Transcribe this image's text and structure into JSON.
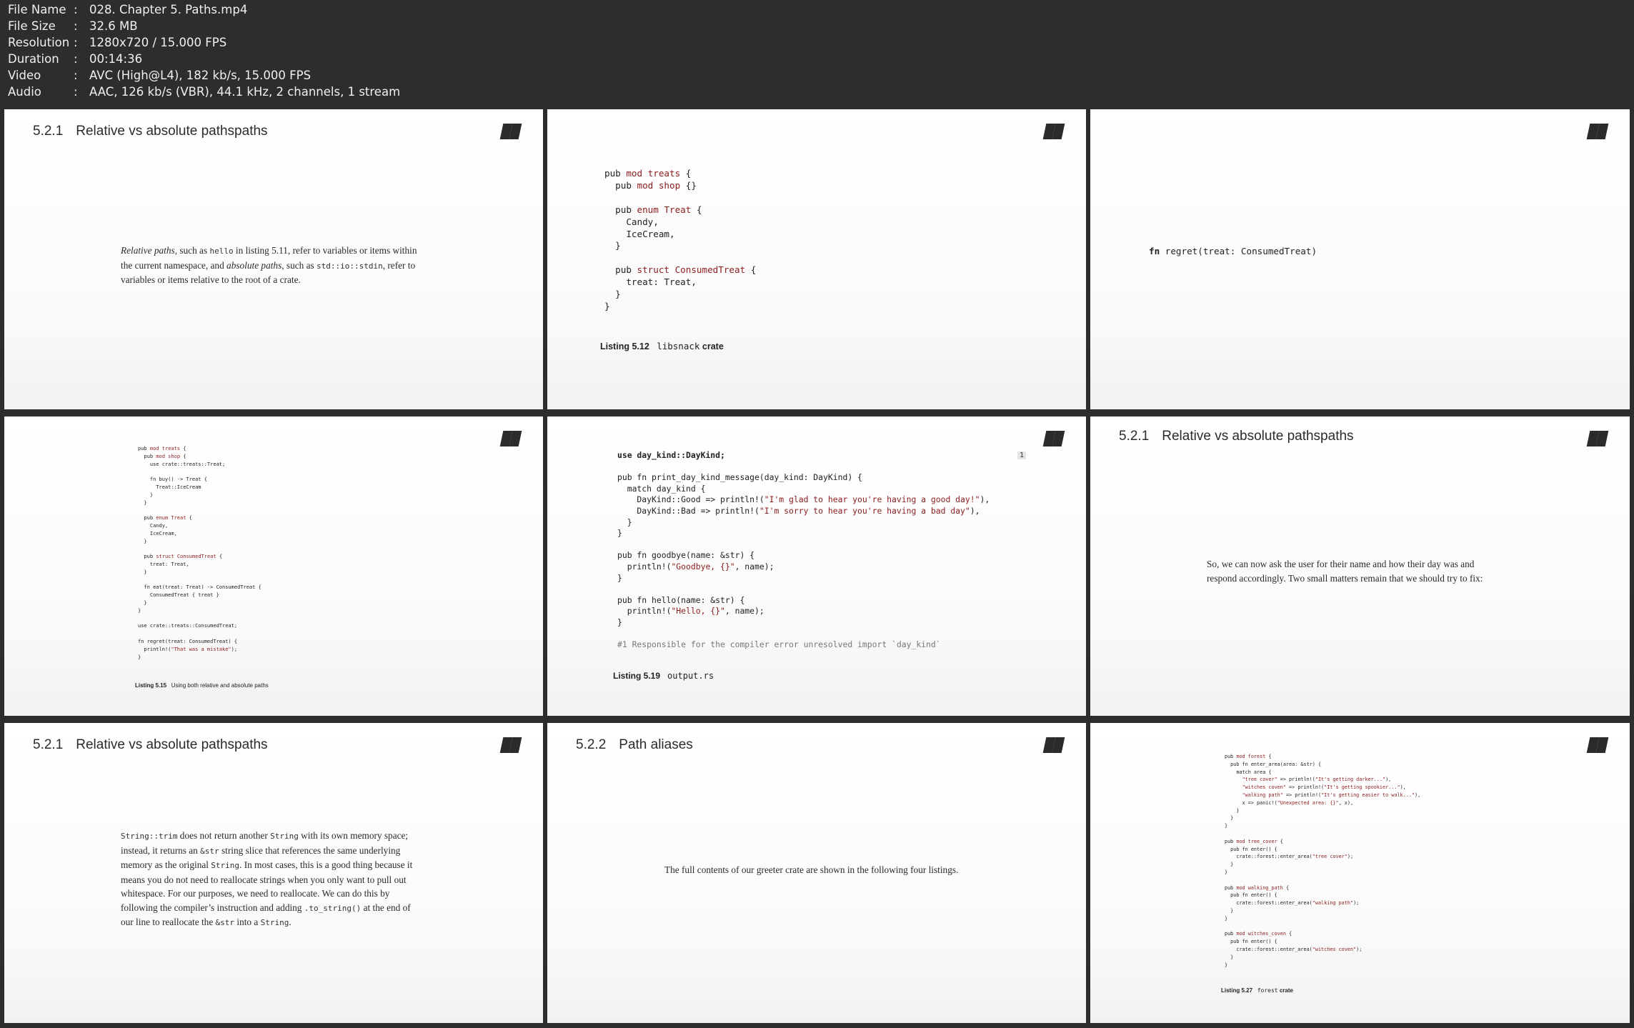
{
  "info": {
    "rows": [
      {
        "key": "File Name",
        "value": "028. Chapter 5. Paths.mp4"
      },
      {
        "key": "File Size",
        "value": "32.6 MB"
      },
      {
        "key": "Resolution",
        "value": "1280x720 / 15.000 FPS"
      },
      {
        "key": "Duration",
        "value": "00:14:36"
      },
      {
        "key": "Video",
        "value": "AVC (High@L4), 182 kb/s, 15.000 FPS"
      },
      {
        "key": "Audio",
        "value": "AAC, 126 kb/s (VBR), 44.1 kHz, 2 channels, 1 stream"
      }
    ]
  },
  "slides": {
    "s1": {
      "section_num": "5.2.1",
      "section_title": "Relative vs absolute pathspaths",
      "em1": "Relative paths",
      "t1": ", such as ",
      "c1": "hello",
      "t2": " in listing 5.11, refer to variables or items within",
      "t3": "the current namespace, and ",
      "em2": "absolute paths",
      "t4": ", such as ",
      "c2": "std::io::stdin",
      "t5": ", refer to",
      "t6": "variables or items relative to the root of a crate."
    },
    "s2": {
      "code_lines": [
        "pub mod treats {",
        "  pub mod shop {}",
        "",
        "  pub enum Treat {",
        "    Candy,",
        "    IceCream,",
        "  }",
        "",
        "  pub struct ConsumedTreat {",
        "    treat: Treat,",
        "  }",
        "}"
      ],
      "caption_label": "Listing 5.12",
      "caption_code": "libsnack",
      "caption_text": "crate"
    },
    "s3": {
      "code_bold": "fn",
      "code_rest": " regret(treat: ConsumedTreat)"
    },
    "s4": {
      "code_lines": [
        "pub mod treats {",
        "  pub mod shop {",
        "    use crate::treats::Treat;",
        "",
        "    fn buy() -> Treat {",
        "      Treat::IceCream",
        "    }",
        "  }",
        "",
        "  pub enum Treat {",
        "    Candy,",
        "    IceCream,",
        "  }",
        "",
        "  pub struct ConsumedTreat {",
        "    treat: Treat,",
        "  }",
        "",
        "  fn eat(treat: Treat) -> ConsumedTreat {",
        "    ConsumedTreat { treat }",
        "  }",
        "}",
        "",
        "use crate::treats::ConsumedTreat;",
        "",
        "fn regret(treat: ConsumedTreat) {",
        "  println!(\"That was a mistake\");",
        "}"
      ],
      "caption_label": "Listing 5.15",
      "caption_text": "Using both relative and absolute paths"
    },
    "s5": {
      "code_lines": [
        "use day_kind::DayKind;",
        "",
        "pub fn print_day_kind_message(day_kind: DayKind) {",
        "  match day_kind {",
        "    DayKind::Good => println!(\"I'm glad to hear you're having a good day!\"),",
        "    DayKind::Bad => println!(\"I'm sorry to hear you're having a bad day\"),",
        "  }",
        "}",
        "",
        "pub fn goodbye(name: &str) {",
        "  println!(\"Goodbye, {}\", name);",
        "}",
        "",
        "pub fn hello(name: &str) {",
        "  println!(\"Hello, {}\", name);",
        "}",
        "",
        "#1 Responsible for the compiler error unresolved import `day_kind`"
      ],
      "badge": "1",
      "caption_label": "Listing 5.19",
      "caption_code": "output.rs"
    },
    "s6": {
      "section_num": "5.2.1",
      "section_title": "Relative vs absolute pathspaths",
      "line1": "So, we can now ask the user for their name and how their day was and",
      "line2": "respond accordingly. Two small matters remain that we should try to fix:"
    },
    "s7": {
      "section_num": "5.2.1",
      "section_title": "Relative vs absolute pathspaths",
      "c1": "String::trim",
      "t1": " does not return another ",
      "c2": "String",
      "t2": " with its own memory space;",
      "t3": "instead, it returns an ",
      "c3": "&str",
      "t4": " string slice that references the same underlying",
      "t5": "memory as the original ",
      "c4": "String",
      "t6": ". In most cases, this is a good thing because it",
      "t7": "means you do not need to reallocate strings when you only want to pull out",
      "t8": "whitespace. For our purposes, we need to reallocate. We can do this by",
      "t9": "following the compiler’s instruction and adding ",
      "c5": ".to_string()",
      "t10": " at the end of",
      "t11": "our line to reallocate the ",
      "c6": "&str",
      "t12": " into a ",
      "c7": "String",
      "t13": "."
    },
    "s8": {
      "section_num": "5.2.2",
      "section_title": "Path aliases",
      "text": "The full contents of our greeter crate are shown in the following four listings."
    },
    "s9": {
      "code_lines": [
        "pub mod forest {",
        "  pub fn enter_area(area: &str) {",
        "    match area {",
        "      \"tree cover\" => println!(\"It's getting darker...\"),",
        "      \"witches coven\" => println!(\"It's getting spookier...\"),",
        "      \"walking path\" => println!(\"It's getting easier to walk...\"),",
        "      x => panic!(\"Unexpected area: {}\", x),",
        "    }",
        "  }",
        "}",
        "",
        "pub mod tree_cover {",
        "  pub fn enter() {",
        "    crate::forest::enter_area(\"tree cover\");",
        "  }",
        "}",
        "",
        "pub mod walking_path {",
        "  pub fn enter() {",
        "    crate::forest::enter_area(\"walking path\");",
        "  }",
        "}",
        "",
        "pub mod witches_coven {",
        "  pub fn enter() {",
        "    crate::forest::enter_area(\"witches coven\");",
        "  }",
        "}"
      ],
      "caption_label": "Listing 5.27",
      "caption_code": "forest",
      "caption_text": "crate"
    }
  }
}
